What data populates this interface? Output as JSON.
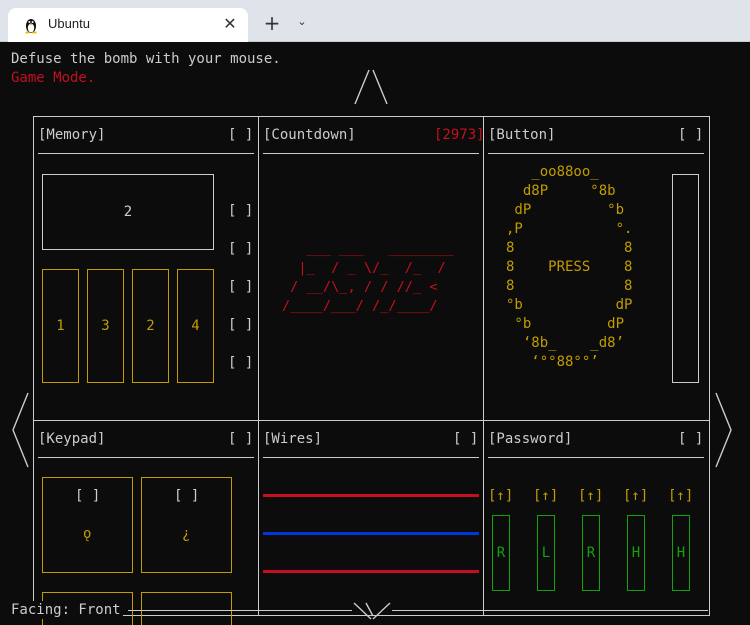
{
  "browser": {
    "tab_title": "Ubuntu",
    "close_glyph": "✕",
    "new_tab_glyph": "+",
    "menu_glyph": "⌄"
  },
  "terminal": {
    "instruction": "Defuse the bomb with your mouse.",
    "mode": "Game Mode.",
    "facing": "Facing: Front"
  },
  "modules": {
    "memory": {
      "title": "[Memory]",
      "status": "[ ]",
      "display": "2",
      "buttons": [
        "1",
        "3",
        "2",
        "4"
      ],
      "stages": [
        "[ ]",
        "[ ]",
        "[ ]",
        "[ ]",
        "[ ]"
      ]
    },
    "countdown": {
      "title": "[Countdown]",
      "timer": "[2973]",
      "art": "   ___ ___   ________\n  |_  / _ \\/_  /_  /\n / __/\\_, / / //_ <\n/____/___/ /_/____/"
    },
    "button": {
      "title": "[Button]",
      "status": "[ ]",
      "art": "   _oo88oo_\n  d8P     °8b\n dP         °b\n,P           °.\n8             8\n8    PRESS    8\n8             8\n°b           dP\n °b         dP\n  ‘8b_    _d8’\n   ‘°°88°°’",
      "label": "PRESS"
    },
    "keypad": {
      "title": "[Keypad]",
      "status": "[ ]",
      "keys": [
        {
          "status": "[ ]",
          "symbol": "ǫ"
        },
        {
          "status": "[ ]",
          "symbol": "¿"
        }
      ]
    },
    "wires": {
      "title": "[Wires]",
      "status": "[ ]",
      "colors": [
        "#c50f1f",
        "#0037da",
        "#c50f1f"
      ]
    },
    "password": {
      "title": "[Password]",
      "status": "[ ]",
      "arrows": [
        "[↑]",
        "[↑]",
        "[↑]",
        "[↑]",
        "[↑]"
      ],
      "letters": [
        "R",
        "L",
        "R",
        "H",
        "H"
      ]
    }
  },
  "nav": {
    "up": "/\\",
    "down": "\\//",
    "left": "<",
    "right": ">"
  }
}
